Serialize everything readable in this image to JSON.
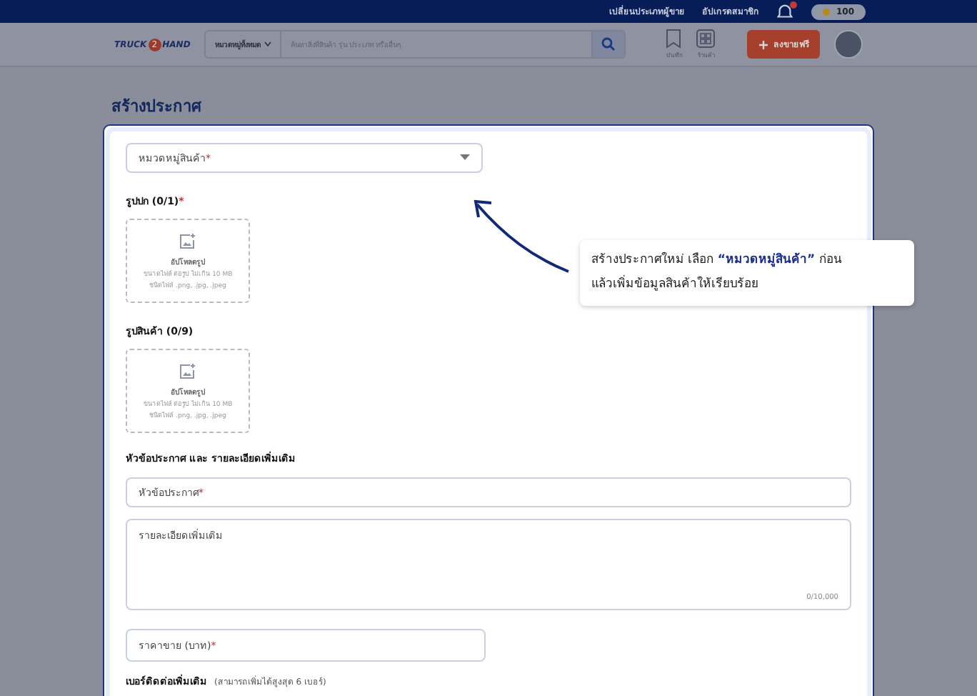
{
  "top_bar": {
    "links": [
      "เปลี่ยนประเภทผู้ขาย",
      "อัปเกรดสมาชิก"
    ],
    "notification_badge": true,
    "coins": "100"
  },
  "nav": {
    "logo_left": "TRUCK",
    "logo_mid": "2",
    "logo_right": "HAND",
    "category": "หมวดหมู่ทั้งหมด",
    "search_placeholder": "ค้นหาสิ่งที่สินค้า รุ่น ประเภท หรืออื่นๆ",
    "icons": [
      {
        "kind": "bookmark",
        "label": "บันทึก"
      },
      {
        "kind": "grid",
        "label": "ร้านค้า"
      }
    ],
    "post_button": "ลงขายฟรี"
  },
  "page_title": "สร้างประกาศ",
  "form": {
    "required_mark": "*",
    "category": {
      "placeholder": "หมวดหมู่สินค้า",
      "required": true
    },
    "uploads": [
      {
        "label": "รูปปก (0/1)",
        "required": true,
        "title": "อัปโหลดรูป",
        "size_hint": "ขนาดไฟล์ ต่อรูป ไม่เกิน 10 MB",
        "type_hint": "ชนิดไฟล์ .png, .jpg, .jpeg"
      },
      {
        "label": "รูปสินค้า (0/9)",
        "required": false,
        "title": "อัปโหลดรูป",
        "size_hint": "ขนาดไฟล์ ต่อรูป ไม่เกิน 10 MB",
        "type_hint": "ชนิดไฟล์ .png, .jpg, .jpeg"
      }
    ],
    "section_heading": "หัวข้อประกาศ และ รายละเอียดเพิ่มเติม",
    "title_field": {
      "placeholder": "หัวข้อประกาศ",
      "required": true
    },
    "details_field": {
      "placeholder": "รายละเอียดเพิ่มเติม",
      "counter": "0/10,000"
    },
    "price_field": {
      "placeholder": "ราคาขาย (บาท)",
      "required": true
    },
    "phone_heading": "เบอร์ติดต่อเพิ่มเติม",
    "phone_note": "(สามารถเพิ่มได้สูงสุด 6 เบอร์)"
  },
  "tooltip": {
    "lines": [
      "สร้างประกาศใหม่ เลือก **“หมวดหมู่สินค้า”** ก่อน",
      "แล้วเพิ่มข้อมูลสินค้าให้เรียบร้อย"
    ]
  }
}
